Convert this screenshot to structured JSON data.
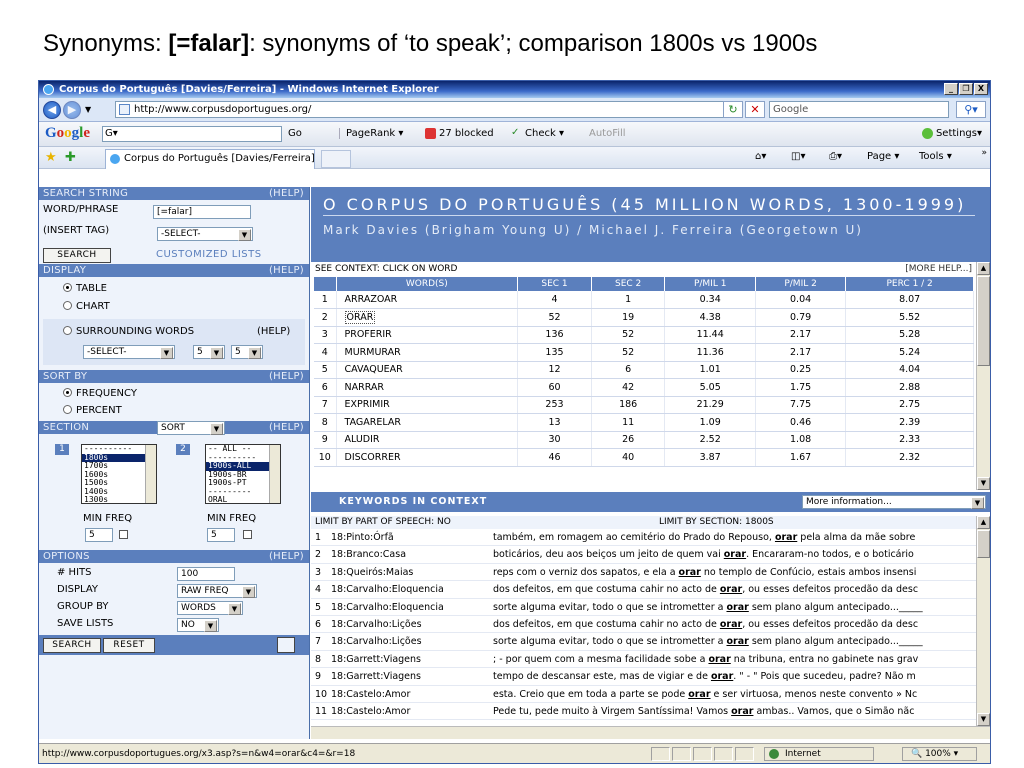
{
  "slide": {
    "title_prefix": "Synonyms: ",
    "title_bold": "[=falar]",
    "title_suffix": ": synonyms of ‘to speak’; comparison 1800s vs 1900s"
  },
  "window": {
    "title": "Corpus do Português [Davies/Ferreira] - Windows Internet Explorer",
    "controls": [
      "_",
      "º",
      "X"
    ]
  },
  "address_bar": {
    "url": "http://www.corpusdoportugues.org/",
    "search_placeholder": "Google"
  },
  "google_bar": {
    "logo": "Google",
    "select": "G▾",
    "go": "Go",
    "pagerank": "PageRank ▾",
    "blocked": "27 blocked",
    "check": "Check ▾",
    "autofill": "AutoFill",
    "settings": "Settings▾"
  },
  "fav_bar": {
    "tab": "Corpus do Português [Davies/Ferreira]",
    "page": "Page ▾",
    "tools": "Tools ▾"
  },
  "left_panel": {
    "search_string_hdr": "SEARCH STRING",
    "help": "(HELP)",
    "word_phrase_label": "WORD/PHRASE",
    "word_phrase_value": "[=falar]",
    "insert_tag_label": "(INSERT TAG)",
    "insert_tag_value": "-SELECT-",
    "search_btn": "SEARCH",
    "customized_lists": "CUSTOMIZED LISTS",
    "display_hdr": "DISPLAY",
    "display_table": "TABLE",
    "display_chart": "CHART",
    "surrounding_words": "SURROUNDING WORDS",
    "surr_select": "-SELECT-",
    "surr_left": "5",
    "surr_right": "5",
    "sort_by_hdr": "SORT BY",
    "sort_frequency": "FREQUENCY",
    "sort_percent": "PERCENT",
    "section_hdr": "SECTION",
    "section_sort": "SORT",
    "sec1_badge": "1",
    "sec2_badge": "2",
    "sec1_items": [
      "----------",
      "1800s",
      "1700s",
      "1600s",
      "1500s",
      "1400s",
      "1300s"
    ],
    "sec2_items": [
      "-- ALL --",
      "----------",
      "1900s-ALL",
      "1900s-BR",
      "1900s-PT",
      "---------",
      "ORAL"
    ],
    "min_freq_label": "MIN FREQ",
    "min_freq_1": "5",
    "min_freq_2": "5",
    "options_hdr": "OPTIONS",
    "hits_label": "# HITS",
    "hits_value": "100",
    "display_label": "DISPLAY",
    "display_value": "RAW FREQ",
    "group_by_label": "GROUP BY",
    "group_by_value": "WORDS",
    "save_lists_label": "SAVE LISTS",
    "save_lists_value": "NO",
    "search_btn2": "SEARCH",
    "reset_btn": "RESET"
  },
  "banner": {
    "title": "O CORPUS DO PORTUGUÊS (45 MILLION WORDS, 1300-1999)",
    "authors": "Mark Davies (Brigham Young U) / Michael J. Ferreira (Georgetown U)"
  },
  "freq_table": {
    "context_hint": "SEE CONTEXT: CLICK ON WORD",
    "more_help": "[MORE HELP...]",
    "headers": [
      "",
      "WORD(S)",
      "SEC 1",
      "SEC 2",
      "P/MIL 1",
      "P/MIL 2",
      "PERC 1 / 2"
    ],
    "rows": [
      {
        "n": "1",
        "word": "ARRAZOAR",
        "sec1": "4",
        "sec2": "1",
        "pmil1": "0.34",
        "pmil2": "0.04",
        "perc": "8.07"
      },
      {
        "n": "2",
        "word": "ORAR",
        "sec1": "52",
        "sec2": "19",
        "pmil1": "4.38",
        "pmil2": "0.79",
        "perc": "5.52"
      },
      {
        "n": "3",
        "word": "PROFERIR",
        "sec1": "136",
        "sec2": "52",
        "pmil1": "11.44",
        "pmil2": "2.17",
        "perc": "5.28"
      },
      {
        "n": "4",
        "word": "MURMURAR",
        "sec1": "135",
        "sec2": "52",
        "pmil1": "11.36",
        "pmil2": "2.17",
        "perc": "5.24"
      },
      {
        "n": "5",
        "word": "CAVAQUEAR",
        "sec1": "12",
        "sec2": "6",
        "pmil1": "1.01",
        "pmil2": "0.25",
        "perc": "4.04"
      },
      {
        "n": "6",
        "word": "NARRAR",
        "sec1": "60",
        "sec2": "42",
        "pmil1": "5.05",
        "pmil2": "1.75",
        "perc": "2.88"
      },
      {
        "n": "7",
        "word": "EXPRIMIR",
        "sec1": "253",
        "sec2": "186",
        "pmil1": "21.29",
        "pmil2": "7.75",
        "perc": "2.75"
      },
      {
        "n": "8",
        "word": "TAGARELAR",
        "sec1": "13",
        "sec2": "11",
        "pmil1": "1.09",
        "pmil2": "0.46",
        "perc": "2.39"
      },
      {
        "n": "9",
        "word": "ALUDIR",
        "sec1": "30",
        "sec2": "26",
        "pmil1": "2.52",
        "pmil2": "1.08",
        "perc": "2.33"
      },
      {
        "n": "10",
        "word": "DISCORRER",
        "sec1": "46",
        "sec2": "40",
        "pmil1": "3.87",
        "pmil2": "1.67",
        "perc": "2.32"
      }
    ]
  },
  "kwic": {
    "header": "KEYWORDS IN CONTEXT",
    "more_info": "More information...",
    "limit_pos": "LIMIT BY PART OF SPEECH: NO",
    "limit_section": "LIMIT BY SECTION: 1800S",
    "rows": [
      {
        "n": "1",
        "src": "18:Pinto:Órfã",
        "pre": "também, em romagem ao cemitério do Prado do Repouso, ",
        "kw": "orar",
        "post": " pela alma da mãe sobre"
      },
      {
        "n": "2",
        "src": "18:Branco:Casa",
        "pre": "boticários, deu aos beiços um jeito de quem vai ",
        "kw": "orar",
        "post": ". Encararam-no todos, e o boticário"
      },
      {
        "n": "3",
        "src": "18:Queirós:Maias",
        "pre": "reps com o verniz dos sapatos, e ela a ",
        "kw": "orar",
        "post": " no templo de Confúcio, estais ambos insensi"
      },
      {
        "n": "4",
        "src": "18:Carvalho:Eloquencia",
        "pre": "dos defeitos, em que costuma cahir no acto de ",
        "kw": "orar",
        "post": ", ou esses defeitos procedão da desc"
      },
      {
        "n": "5",
        "src": "18:Carvalho:Eloquencia",
        "pre": "sorte alguma evitar, todo o que se intrometter a ",
        "kw": "orar",
        "post": " sem plano algum antecipado..._____"
      },
      {
        "n": "6",
        "src": "18:Carvalho:Lições",
        "pre": "dos defeitos, em que costuma cahir no acto de ",
        "kw": "orar",
        "post": ", ou esses defeitos procedão da desc"
      },
      {
        "n": "7",
        "src": "18:Carvalho:Lições",
        "pre": "sorte alguma evitar, todo o que se intrometter a ",
        "kw": "orar",
        "post": " sem plano algum antecipado..._____"
      },
      {
        "n": "8",
        "src": "18:Garrett:Viagens",
        "pre": "; - por quem com a mesma facilidade sobe a ",
        "kw": "orar",
        "post": " na tribuna, entra no gabinete nas grav"
      },
      {
        "n": "9",
        "src": "18:Garrett:Viagens",
        "pre": "tempo de descansar este, mas de vigiar e de ",
        "kw": "orar",
        "post": ". \" - \" Pois que sucedeu, padre? Não m"
      },
      {
        "n": "10",
        "src": "18:Castelo:Amor",
        "pre": "esta. Creio que em toda a parte se pode ",
        "kw": "orar",
        "post": " e ser virtuosa, menos neste convento » Nc"
      },
      {
        "n": "11",
        "src": "18:Castelo:Amor",
        "pre": "Pede tu, pede muito à Virgem Santíssima! Vamos ",
        "kw": "orar",
        "post": " ambas.. Vamos, que o Simão nãc"
      }
    ]
  },
  "status_bar": {
    "url": "http://www.corpusdoportugues.org/x3.asp?s=n&w4=orar&c4=&r=18",
    "zone": "Internet",
    "zoom": "100%"
  },
  "colors": {
    "panel_blue": "#5b7fbd",
    "panel_light": "#eef3fb"
  }
}
